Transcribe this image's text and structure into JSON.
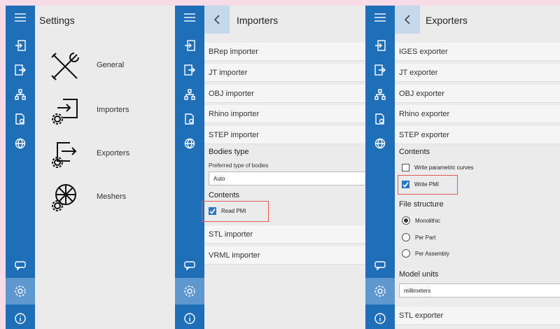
{
  "settings": {
    "title": "Settings",
    "items": [
      {
        "label": "General",
        "icon": "tools-icon"
      },
      {
        "label": "Importers",
        "icon": "import-gear-icon"
      },
      {
        "label": "Exporters",
        "icon": "export-gear-icon"
      },
      {
        "label": "Meshers",
        "icon": "mesh-gear-icon"
      }
    ]
  },
  "importers": {
    "title": "Importers",
    "rows_top": [
      "BRep importer",
      "JT importer",
      "OBJ importer",
      "Rhino importer",
      "STEP importer"
    ],
    "bodies_type_label": "Bodies type",
    "preferred_label": "Preferred type of bodies",
    "preferred_value": "Auto",
    "contents_label": "Contents",
    "read_pmi_label": "Read PMI",
    "read_pmi_checked": true,
    "rows_bottom": [
      "STL importer",
      "VRML importer"
    ]
  },
  "exporters": {
    "title": "Exporters",
    "rows_top": [
      "IGES exporter",
      "JT exporter",
      "OBJ exporter",
      "Rhino exporter",
      "STEP exporter"
    ],
    "contents_label": "Contents",
    "write_parametric_label": "Write parametric curves",
    "write_parametric_checked": false,
    "write_pmi_label": "Write PMI",
    "write_pmi_checked": true,
    "file_structure_label": "File structure",
    "file_structure_options": [
      "Monolithic",
      "Per Part",
      "Per Assembly"
    ],
    "file_structure_selected": "Monolithic",
    "model_units_label": "Model units",
    "model_units_value": "millimeters",
    "rows_bottom": [
      "STL exporter"
    ]
  },
  "colors": {
    "rail": "#1f6fb8",
    "rail_active": "#5f97cf",
    "highlight": "#e25b5b",
    "checkbox": "#2b77c4"
  }
}
